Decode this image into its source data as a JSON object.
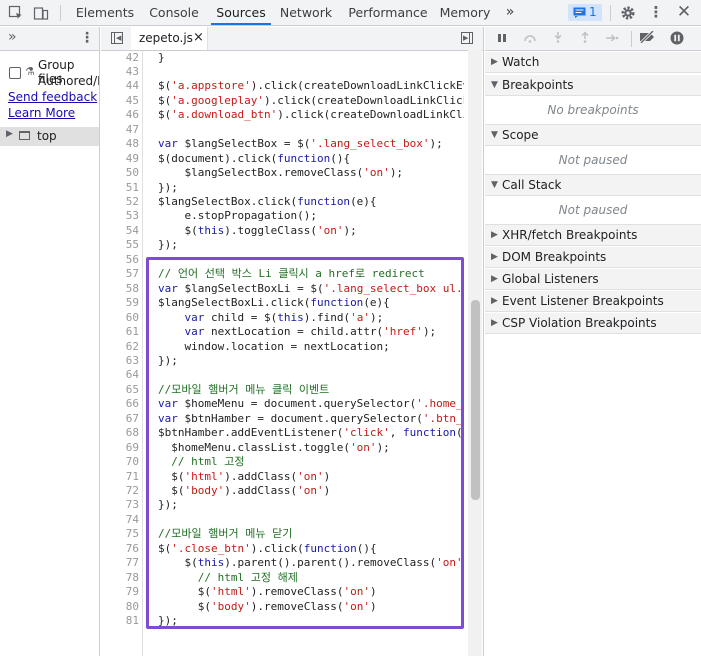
{
  "toolbar": {
    "tabs": [
      "Elements",
      "Console",
      "Sources",
      "Network",
      "Performance",
      "Memory"
    ],
    "selected_tab": "Sources",
    "more_tabs": "»",
    "messages_count": "1",
    "settings_icon": "gear-icon",
    "menu_icon": "kebab-icon",
    "close_icon": "close-icon"
  },
  "left_panel": {
    "more": "»",
    "group_files_label": "Group files",
    "authored_label": "Authored/D",
    "send_feedback": "Send feedback",
    "learn_more": "Learn More",
    "tree_top": "top"
  },
  "editor": {
    "file_tab": "zepeto.js",
    "close": "×",
    "line_numbers": [
      "42",
      "43",
      "44",
      "45",
      "46",
      "47",
      "48",
      "49",
      "50",
      "51",
      "52",
      "53",
      "54",
      "55",
      "56",
      "57",
      "58",
      "59",
      "60",
      "61",
      "62",
      "63",
      "64",
      "65",
      "66",
      "67",
      "68",
      "69",
      "70",
      "71",
      "72",
      "73",
      "74",
      "75",
      "76",
      "77",
      "78",
      "79",
      "80",
      "81"
    ],
    "lines": [
      [
        {
          "t": "}",
          "c": "v"
        }
      ],
      [],
      [
        {
          "t": "$(",
          "c": "v"
        },
        {
          "t": "'a.appstore'",
          "c": "s"
        },
        {
          "t": ").click(createDownloadLinkClickEv",
          "c": "v"
        }
      ],
      [
        {
          "t": "$(",
          "c": "v"
        },
        {
          "t": "'a.googleplay'",
          "c": "s"
        },
        {
          "t": ").click(createDownloadLinkClick",
          "c": "v"
        }
      ],
      [
        {
          "t": "$(",
          "c": "v"
        },
        {
          "t": "'a.download_btn'",
          "c": "s"
        },
        {
          "t": ").click(createDownloadLinkCli",
          "c": "v"
        }
      ],
      [],
      [
        {
          "t": "var",
          "c": "k"
        },
        {
          "t": " $langSelectBox = $(",
          "c": "v"
        },
        {
          "t": "'.lang_select_box'",
          "c": "s"
        },
        {
          "t": ");",
          "c": "v"
        }
      ],
      [
        {
          "t": "$(document).click(",
          "c": "v"
        },
        {
          "t": "function",
          "c": "k"
        },
        {
          "t": "(){",
          "c": "v"
        }
      ],
      [
        {
          "t": "    $langSelectBox.removeClass(",
          "c": "v"
        },
        {
          "t": "'on'",
          "c": "s"
        },
        {
          "t": ");",
          "c": "v"
        }
      ],
      [
        {
          "t": "});",
          "c": "v"
        }
      ],
      [
        {
          "t": "$langSelectBox.click(",
          "c": "v"
        },
        {
          "t": "function",
          "c": "k"
        },
        {
          "t": "(e){",
          "c": "v"
        }
      ],
      [
        {
          "t": "    e.stopPropagation();",
          "c": "v"
        }
      ],
      [
        {
          "t": "    $(",
          "c": "v"
        },
        {
          "t": "this",
          "c": "k"
        },
        {
          "t": ").toggleClass(",
          "c": "v"
        },
        {
          "t": "'on'",
          "c": "s"
        },
        {
          "t": ");",
          "c": "v"
        }
      ],
      [
        {
          "t": "});",
          "c": "v"
        }
      ],
      [],
      [
        {
          "t": "// 언어 선택 박스 Li 클릭시 a href로 redirect",
          "c": "c"
        }
      ],
      [
        {
          "t": "var",
          "c": "k"
        },
        {
          "t": " $langSelectBoxLi = $(",
          "c": "v"
        },
        {
          "t": "'.lang_select_box ul.s",
          "c": "s"
        }
      ],
      [
        {
          "t": "$langSelectBoxLi.click(",
          "c": "v"
        },
        {
          "t": "function",
          "c": "k"
        },
        {
          "t": "(e){",
          "c": "v"
        }
      ],
      [
        {
          "t": "    ",
          "c": "v"
        },
        {
          "t": "var",
          "c": "k"
        },
        {
          "t": " child = $(",
          "c": "v"
        },
        {
          "t": "this",
          "c": "k"
        },
        {
          "t": ").find(",
          "c": "v"
        },
        {
          "t": "'a'",
          "c": "s"
        },
        {
          "t": ");",
          "c": "v"
        }
      ],
      [
        {
          "t": "    ",
          "c": "v"
        },
        {
          "t": "var",
          "c": "k"
        },
        {
          "t": " nextLocation = child.attr(",
          "c": "v"
        },
        {
          "t": "'href'",
          "c": "s"
        },
        {
          "t": ");",
          "c": "v"
        }
      ],
      [
        {
          "t": "    window.location = nextLocation;",
          "c": "v"
        }
      ],
      [
        {
          "t": "});",
          "c": "v"
        }
      ],
      [],
      [
        {
          "t": "//모바일 햄버거 메뉴 클릭 이벤트",
          "c": "c"
        }
      ],
      [
        {
          "t": "var",
          "c": "k"
        },
        {
          "t": " $homeMenu = document.querySelector(",
          "c": "v"
        },
        {
          "t": "'.home_m",
          "c": "s"
        }
      ],
      [
        {
          "t": "var",
          "c": "k"
        },
        {
          "t": " $btnHamber = document.querySelector(",
          "c": "v"
        },
        {
          "t": "'.btn_h",
          "c": "s"
        }
      ],
      [
        {
          "t": "$btnHamber.addEventListener(",
          "c": "v"
        },
        {
          "t": "'click'",
          "c": "s"
        },
        {
          "t": ", ",
          "c": "v"
        },
        {
          "t": "function",
          "c": "k"
        },
        {
          "t": "()",
          "c": "v"
        }
      ],
      [
        {
          "t": "  $homeMenu.classList.toggle(",
          "c": "v"
        },
        {
          "t": "'on'",
          "c": "s"
        },
        {
          "t": ");",
          "c": "v"
        }
      ],
      [
        {
          "t": "  // html 고정",
          "c": "c"
        }
      ],
      [
        {
          "t": "  $(",
          "c": "v"
        },
        {
          "t": "'html'",
          "c": "s"
        },
        {
          "t": ").addClass(",
          "c": "v"
        },
        {
          "t": "'on'",
          "c": "s"
        },
        {
          "t": ")",
          "c": "v"
        }
      ],
      [
        {
          "t": "  $(",
          "c": "v"
        },
        {
          "t": "'body'",
          "c": "s"
        },
        {
          "t": ").addClass(",
          "c": "v"
        },
        {
          "t": "'on'",
          "c": "s"
        },
        {
          "t": ")",
          "c": "v"
        }
      ],
      [
        {
          "t": "});",
          "c": "v"
        }
      ],
      [],
      [
        {
          "t": "//모바일 햄버거 메뉴 닫기",
          "c": "c"
        }
      ],
      [
        {
          "t": "$(",
          "c": "v"
        },
        {
          "t": "'.close_btn'",
          "c": "s"
        },
        {
          "t": ").click(",
          "c": "v"
        },
        {
          "t": "function",
          "c": "k"
        },
        {
          "t": "(){",
          "c": "v"
        }
      ],
      [
        {
          "t": "    $(",
          "c": "v"
        },
        {
          "t": "this",
          "c": "k"
        },
        {
          "t": ").parent().parent().removeClass(",
          "c": "v"
        },
        {
          "t": "'on'",
          "c": "s"
        },
        {
          "t": ")",
          "c": "v"
        }
      ],
      [
        {
          "t": "      // html 고정 해제",
          "c": "c"
        }
      ],
      [
        {
          "t": "      $(",
          "c": "v"
        },
        {
          "t": "'html'",
          "c": "s"
        },
        {
          "t": ").removeClass(",
          "c": "v"
        },
        {
          "t": "'on'",
          "c": "s"
        },
        {
          "t": ")",
          "c": "v"
        }
      ],
      [
        {
          "t": "      $(",
          "c": "v"
        },
        {
          "t": "'body'",
          "c": "s"
        },
        {
          "t": ").removeClass(",
          "c": "v"
        },
        {
          "t": "'on'",
          "c": "s"
        },
        {
          "t": ")",
          "c": "v"
        }
      ],
      [
        {
          "t": "});",
          "c": "v"
        }
      ]
    ]
  },
  "debugger": {
    "sections": [
      {
        "label": "Watch",
        "expanded": false
      },
      {
        "label": "Breakpoints",
        "expanded": true
      },
      {
        "label": "Scope",
        "expanded": true
      },
      {
        "label": "Call Stack",
        "expanded": true
      },
      {
        "label": "XHR/fetch Breakpoints",
        "expanded": false
      },
      {
        "label": "DOM Breakpoints",
        "expanded": false
      },
      {
        "label": "Global Listeners",
        "expanded": false
      },
      {
        "label": "Event Listener Breakpoints",
        "expanded": false
      },
      {
        "label": "CSP Violation Breakpoints",
        "expanded": false
      }
    ],
    "no_breakpoints": "No breakpoints",
    "scope_status": "Not paused",
    "callstack_status": "Not paused"
  },
  "colors": {
    "accent": "#1a73e8",
    "highlight_border": "#7d4bd6",
    "string": "#c41a16",
    "keyword": "#1a1aa6",
    "comment": "#236e25"
  }
}
